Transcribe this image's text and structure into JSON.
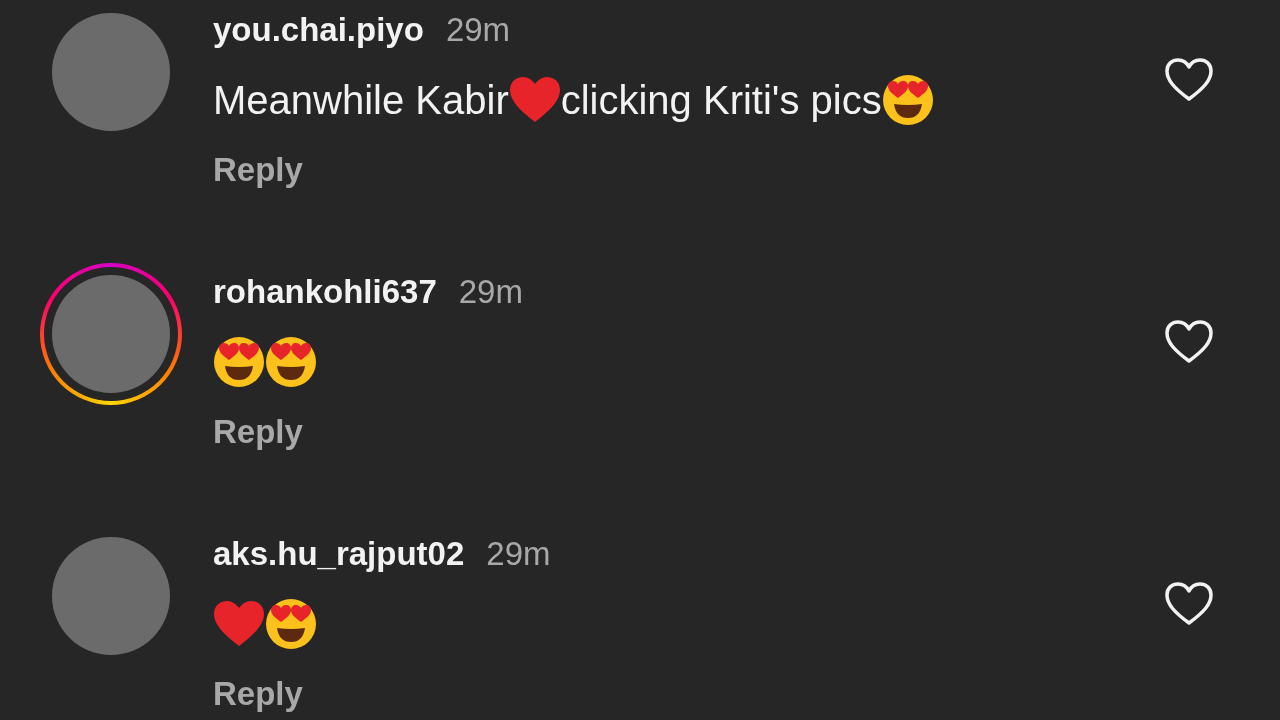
{
  "comments": [
    {
      "username": "you.chai.piyo",
      "time": "29m",
      "story_ring": false,
      "liked": false,
      "content": [
        {
          "kind": "text",
          "text": "Meanwhile Kabir"
        },
        {
          "kind": "heart"
        },
        {
          "kind": "text",
          "text": "clicking Kriti's pics"
        },
        {
          "kind": "heart-eyes"
        }
      ],
      "reply": "Reply"
    },
    {
      "username": "rohankohli637",
      "time": "29m",
      "story_ring": true,
      "liked": false,
      "content": [
        {
          "kind": "heart-eyes"
        },
        {
          "kind": "heart-eyes"
        }
      ],
      "reply": "Reply"
    },
    {
      "username": "aks.hu_rajput02",
      "time": "29m",
      "story_ring": false,
      "liked": false,
      "content": [
        {
          "kind": "heart"
        },
        {
          "kind": "heart-eyes"
        }
      ],
      "reply": "Reply"
    }
  ]
}
